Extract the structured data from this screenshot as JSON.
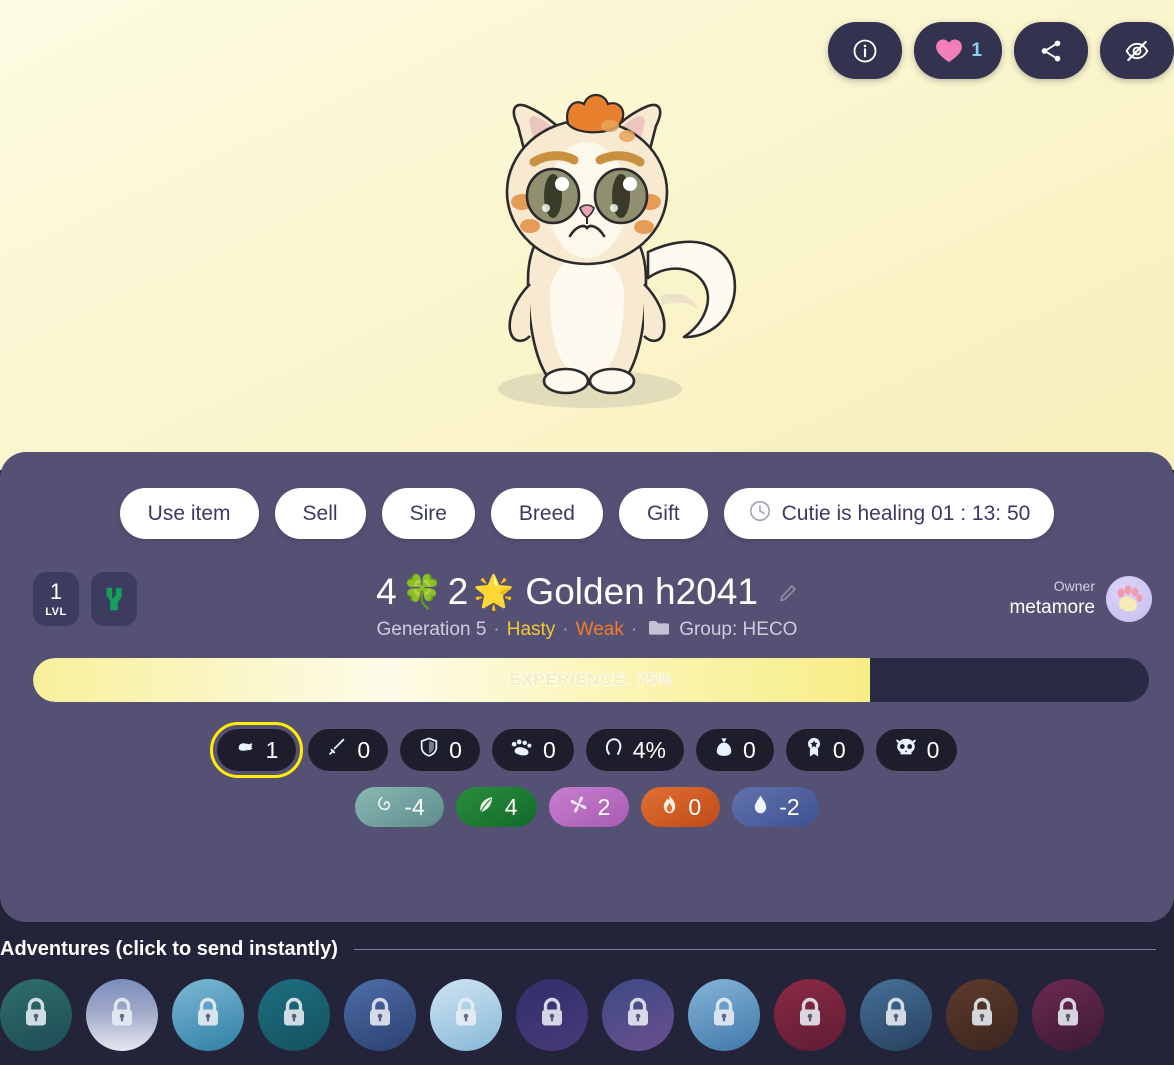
{
  "hero": {
    "actions": [
      {
        "name": "info-button",
        "icon": "info-icon",
        "label": ""
      },
      {
        "name": "like-button",
        "icon": "heart-icon",
        "label": "1"
      },
      {
        "name": "share-button",
        "icon": "share-icon",
        "label": ""
      },
      {
        "name": "hide-button",
        "icon": "eye-off-icon",
        "label": ""
      }
    ],
    "cat_alt": "golden kitten character"
  },
  "panel": {
    "actions": [
      {
        "label": "Use item",
        "name": "use-item-button"
      },
      {
        "label": "Sell",
        "name": "sell-button"
      },
      {
        "label": "Sire",
        "name": "sire-button"
      },
      {
        "label": "Breed",
        "name": "breed-button"
      },
      {
        "label": "Gift",
        "name": "gift-button"
      },
      {
        "label": "Cutie is healing 01 : 13: 50",
        "name": "healing-status-button"
      }
    ],
    "level": {
      "value": "1",
      "caption": "LVL"
    },
    "chain": "heco-logo",
    "title": {
      "clover_count": "4",
      "clover_icon": "🍀",
      "sun_count": "2",
      "sun_icon": "🌟",
      "name": "Golden h2041"
    },
    "subtitle": {
      "generation": "Generation 5",
      "nature": "Hasty",
      "condition": "Weak",
      "group": "Group: HECO",
      "separator": "·"
    },
    "owner": {
      "label": "Owner",
      "name": "metamore"
    },
    "experience": {
      "label": "EXPERIENCE: 75%",
      "percent": 75
    },
    "stats": [
      {
        "icon": "glove-icon",
        "value": "1",
        "selected": true
      },
      {
        "icon": "sword-icon",
        "value": "0",
        "selected": false
      },
      {
        "icon": "shield-icon",
        "value": "0",
        "selected": false
      },
      {
        "icon": "paws-icon",
        "value": "0",
        "selected": false
      },
      {
        "icon": "horseshoe-icon",
        "value": "4%",
        "selected": false
      },
      {
        "icon": "moneybag-icon",
        "value": "0",
        "selected": false
      },
      {
        "icon": "medal-icon",
        "value": "0",
        "selected": false
      },
      {
        "icon": "skull-icon",
        "value": "0",
        "selected": false
      }
    ],
    "elements": [
      {
        "icon": "spiral-icon",
        "value": "-4",
        "color": "#6f9e9c"
      },
      {
        "icon": "leaf-icon",
        "value": "4",
        "color": "#1f7a32"
      },
      {
        "icon": "whirlwind-icon",
        "value": "2",
        "color": "#b96cc0"
      },
      {
        "icon": "flame-icon",
        "value": "0",
        "color": "#cf5a1f"
      },
      {
        "icon": "droplet-icon",
        "value": "-2",
        "color": "#4e5f9e"
      }
    ]
  },
  "adventures": {
    "title": "Adventures (click to send instantly)",
    "items": [
      {
        "name": "adventure-1",
        "locked": true,
        "bg": "linear-gradient(160deg,#2f6e6b,#1d4c55)"
      },
      {
        "name": "adventure-2",
        "locked": true,
        "bg": "linear-gradient(180deg,#7b8dbb 0%,#9fa9c8 45%,#e6e8ef 100%)"
      },
      {
        "name": "adventure-3",
        "locked": true,
        "bg": "linear-gradient(160deg,#7fb9d6,#2e7fa5)"
      },
      {
        "name": "adventure-4",
        "locked": true,
        "bg": "linear-gradient(160deg,#1d6e80,#15525f)"
      },
      {
        "name": "adventure-5",
        "locked": true,
        "bg": "linear-gradient(160deg,#4f6da8,#2b4170)"
      },
      {
        "name": "adventure-6",
        "locked": true,
        "bg": "linear-gradient(160deg,#cfe4f2,#86b8d8)"
      },
      {
        "name": "adventure-7",
        "locked": true,
        "bg": "linear-gradient(160deg,#2f2f6b,#4a3a78)"
      },
      {
        "name": "adventure-8",
        "locked": true,
        "bg": "linear-gradient(160deg,#3b4a86,#6b4f8c)"
      },
      {
        "name": "adventure-9",
        "locked": true,
        "bg": "linear-gradient(160deg,#86b5d8,#3f78a8)"
      },
      {
        "name": "adventure-10",
        "locked": true,
        "bg": "linear-gradient(160deg,#8c2a46,#5e1c33)"
      },
      {
        "name": "adventure-11",
        "locked": true,
        "bg": "linear-gradient(160deg,#47709a,#27415e)"
      },
      {
        "name": "adventure-12",
        "locked": true,
        "bg": "linear-gradient(160deg,#5e3a2c,#3b261f)"
      },
      {
        "name": "adventure-13",
        "locked": true,
        "bg": "linear-gradient(160deg,#6d2a52,#3c1a33)"
      }
    ],
    "lock_icon": "lock-icon"
  }
}
